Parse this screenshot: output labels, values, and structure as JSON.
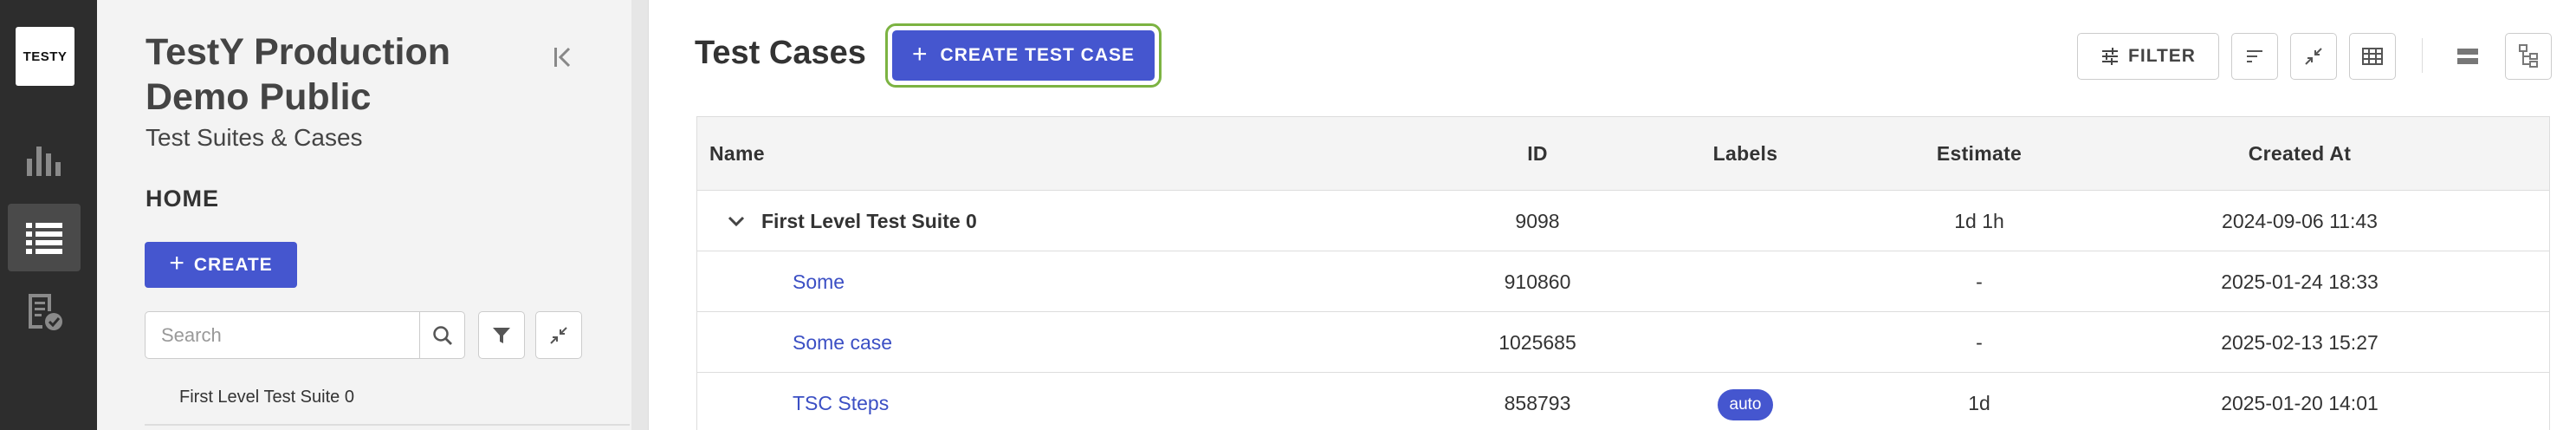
{
  "app": {
    "logo_text": "TESTY"
  },
  "rail": {
    "items": [
      {
        "name": "analytics",
        "icon": "bar-chart-icon",
        "active": false
      },
      {
        "name": "test-suites",
        "icon": "list-icon",
        "active": true
      },
      {
        "name": "test-plans",
        "icon": "report-check-icon",
        "active": false
      }
    ]
  },
  "sidebar": {
    "project_title": "TestY Production Demo Public",
    "subtitle": "Test Suites & Cases",
    "home_label": "HOME",
    "create_label": "CREATE",
    "search": {
      "placeholder": "Search",
      "value": ""
    },
    "tree": [
      {
        "label": "First Level Test Suite 0"
      }
    ]
  },
  "main": {
    "title": "Test Cases",
    "create_test_case_label": "CREATE TEST CASE",
    "filter_label": "FILTER",
    "table": {
      "columns": [
        "Name",
        "ID",
        "Labels",
        "Estimate",
        "Created At"
      ],
      "suite": {
        "name": "First Level Test Suite 0",
        "id": "9098",
        "labels": "",
        "estimate": "1d 1h",
        "created_at": "2024-09-06 11:43"
      },
      "rows": [
        {
          "name": "Some",
          "id": "910860",
          "labels": "",
          "estimate": "-",
          "created_at": "2025-01-24 18:33"
        },
        {
          "name": "Some case",
          "id": "1025685",
          "labels": "",
          "estimate": "-",
          "created_at": "2025-02-13 15:27"
        },
        {
          "name": "TSC Steps",
          "id": "858793",
          "labels": "auto",
          "estimate": "1d",
          "created_at": "2025-01-20 14:01"
        }
      ]
    }
  },
  "colors": {
    "primary": "#4556cf",
    "highlight": "#7cb342",
    "rail_bg": "#2d2d2d",
    "sidebar_bg": "#f3f3f3",
    "link": "#3b4fc4"
  }
}
